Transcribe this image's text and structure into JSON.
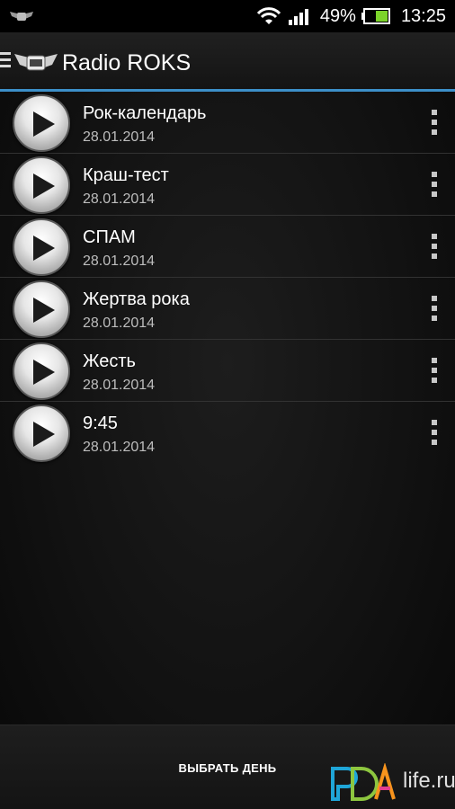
{
  "status_bar": {
    "battery_percent": "49%",
    "time": "13:25",
    "icons": [
      "radio-roks-notification-icon",
      "wifi-icon",
      "signal-icon",
      "battery-icon"
    ]
  },
  "app_bar": {
    "title": "Radio ROKS",
    "logo_icon": "radio-roks-logo-icon",
    "menu_icon": "drawer-menu-icon"
  },
  "colors": {
    "accent": "#3c8fc9",
    "background": "#121212",
    "battery_fill": "#7cd32b"
  },
  "tracks": [
    {
      "title": "Рок-календарь",
      "date": "28.01.2014"
    },
    {
      "title": "Краш-тест",
      "date": "28.01.2014"
    },
    {
      "title": "СПАМ",
      "date": "28.01.2014"
    },
    {
      "title": "Жертва рока",
      "date": "28.01.2014"
    },
    {
      "title": "Жесть",
      "date": "28.01.2014"
    },
    {
      "title": "9:45",
      "date": "28.01.2014"
    }
  ],
  "bottom_bar": {
    "select_day_label": "ВЫБРАТЬ ДЕНЬ",
    "watermark": "life.ru"
  }
}
